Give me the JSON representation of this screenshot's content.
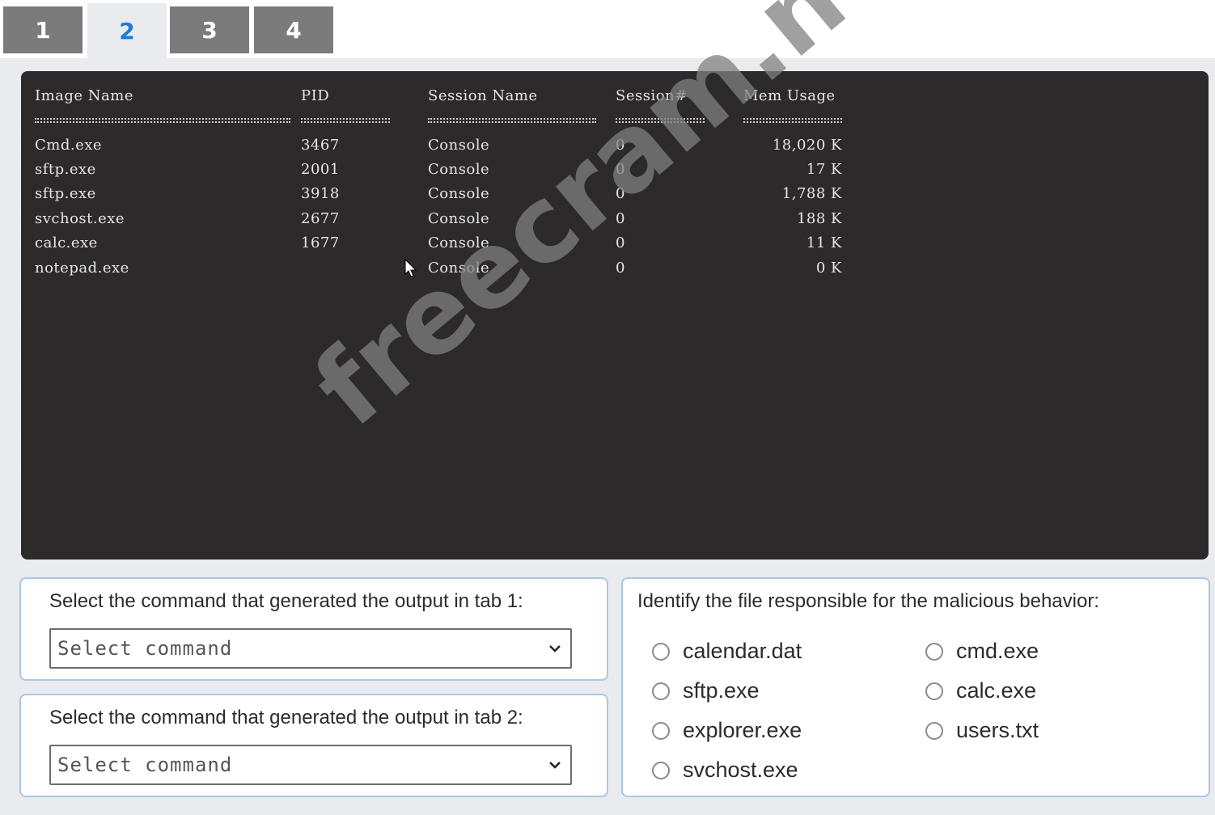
{
  "tabs": [
    {
      "label": "1",
      "active": false
    },
    {
      "label": "2",
      "active": true
    },
    {
      "label": "3",
      "active": false
    },
    {
      "label": "4",
      "active": false
    }
  ],
  "terminal": {
    "headers": {
      "image_name": "Image Name",
      "pid": "PID",
      "session_name": "Session Name",
      "session_num": "Session#",
      "mem_usage": "Mem Usage"
    },
    "rows": [
      {
        "image_name": "Cmd.exe",
        "pid": "3467",
        "session_name": "Console",
        "session_num": "0",
        "mem_usage": "18,020 K"
      },
      {
        "image_name": "sftp.exe",
        "pid": "2001",
        "session_name": "Console",
        "session_num": "0",
        "mem_usage": "17 K"
      },
      {
        "image_name": "sftp.exe",
        "pid": "3918",
        "session_name": "Console",
        "session_num": "0",
        "mem_usage": "1,788 K"
      },
      {
        "image_name": "svchost.exe",
        "pid": "2677",
        "session_name": "Console",
        "session_num": "0",
        "mem_usage": "188 K"
      },
      {
        "image_name": "calc.exe",
        "pid": "1677",
        "session_name": "Console",
        "session_num": "0",
        "mem_usage": "11 K"
      },
      {
        "image_name": "notepad.exe",
        "pid": "",
        "session_name": "Console",
        "session_num": "0",
        "mem_usage": "0 K"
      }
    ]
  },
  "question1": {
    "prompt": "Select the command that generated the output in tab 1:",
    "select_value": "Select command"
  },
  "question2": {
    "prompt": "Select the command that generated the output in tab 2:",
    "select_value": "Select command"
  },
  "question3": {
    "prompt": "Identify the file responsible for the malicious behavior:",
    "options": [
      "calendar.dat",
      "cmd.exe",
      "sftp.exe",
      "calc.exe",
      "explorer.exe",
      "users.txt",
      "svchost.exe"
    ]
  },
  "watermark": "freecram.net",
  "colors": {
    "active_tab_text": "#1e7ad6",
    "inactive_tab_bg": "#7b7b7b",
    "terminal_bg": "#2b2b2b",
    "panel_border": "#a9c7e6"
  }
}
